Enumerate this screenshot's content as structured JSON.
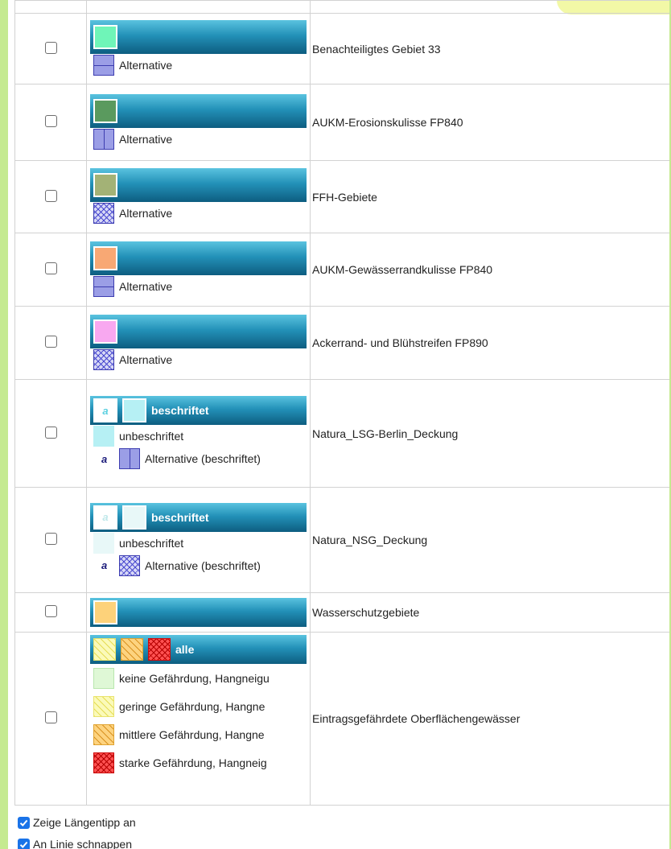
{
  "rows": [
    {
      "name": "Benachteiligtes Gebiet 33",
      "main_swatch_color": "#6ff5b8",
      "alt_label": "Alternative",
      "alt_style": "solid-horizontal-line"
    },
    {
      "name": "AUKM-Erosionskulisse FP840",
      "main_swatch_color": "#5a9a5e",
      "alt_label": "Alternative",
      "alt_style": "solid-vertical-line"
    },
    {
      "name": "FFH-Gebiete",
      "main_swatch_color": "#a3b276",
      "alt_label": "Alternative",
      "alt_style": "crosshatch"
    },
    {
      "name": "AUKM-Gewässerrandkulisse FP840",
      "main_swatch_color": "#f8a874",
      "alt_label": "Alternative",
      "alt_style": "solid-horizontal-line"
    },
    {
      "name": "Ackerrand- und Blühstreifen FP890",
      "main_swatch_color": "#f8a8f0",
      "alt_label": "Alternative",
      "alt_style": "crosshatch"
    },
    {
      "name": "Natura_LSG-Berlin_Deckung",
      "bar_label": "beschriftet",
      "unlabeled": "unbeschriftet",
      "alt_labeled": "Alternative (beschriftet)",
      "swatch_color": "#b6f0f4",
      "sample_letter": "a"
    },
    {
      "name": "Natura_NSG_Deckung",
      "bar_label": "beschriftet",
      "unlabeled": "unbeschriftet",
      "alt_labeled": "Alternative (beschriftet)",
      "swatch_color": "#e8f8f8",
      "sample_letter": "a"
    },
    {
      "name": "Wasserschutzgebiete",
      "main_swatch_color": "#fdd27a"
    },
    {
      "name": "Eintragsgefährdete Oberflächengewässer",
      "bar_label": "alle",
      "items": [
        "keine Gefährdung, Hangneigu",
        "geringe Gefährdung, Hangne",
        "mittlere Gefährdung, Hangne",
        "starke Gefährdung, Hangneig"
      ],
      "item_colors": [
        "#dff8d6",
        "#fbfab9",
        "#fdd37f",
        "#ff5252"
      ]
    }
  ],
  "footer": {
    "show_length_tip": "Zeige Längentipp an",
    "snap_to_line": "An Linie schnappen",
    "show_length_tip_checked": true,
    "snap_to_line_checked": true
  },
  "colors": {
    "page_background": "#c5ea91",
    "header_gradient_top": "#5ac3df",
    "header_gradient_bottom": "#0d5d80",
    "alternative_fill": "#9b9ee6",
    "alternative_stroke": "#3d3db0",
    "checkbox_checked": "#1a73e8"
  }
}
